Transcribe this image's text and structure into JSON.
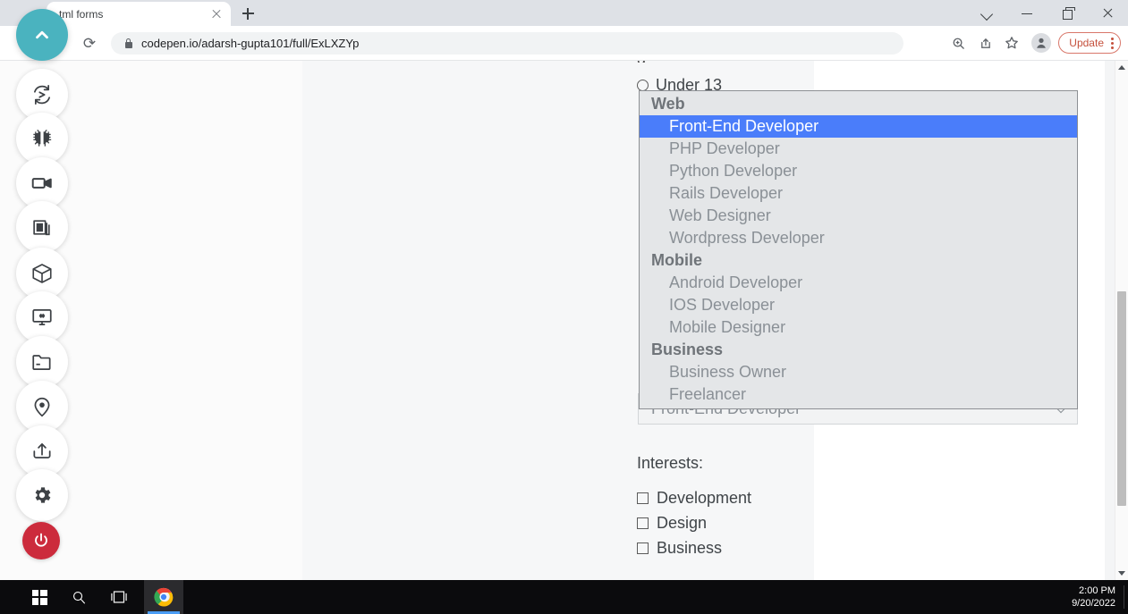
{
  "browser": {
    "tab": {
      "title": "tml forms",
      "close_icon": "close-icon"
    },
    "new_tab_icon": "plus-icon",
    "window_controls": [
      {
        "name": "chevron-down-icon",
        "label": "˅"
      },
      {
        "name": "minimize-icon",
        "label": "—"
      },
      {
        "name": "restore-icon",
        "label": "❐"
      },
      {
        "name": "close-icon",
        "label": "✕"
      }
    ],
    "reload_icon": "⟳",
    "lock_icon": "lock-icon",
    "url": "codepen.io/adarsh-gupta101/full/ExLXZYp",
    "toolbar_icons": [
      {
        "name": "zoom-icon",
        "glyph": "⊕"
      },
      {
        "name": "share-icon",
        "glyph": "↱"
      },
      {
        "name": "bookmark-star-icon",
        "glyph": "☆"
      }
    ],
    "profile_icon": "profile-avatar-icon",
    "update_button": {
      "label": "Update",
      "color": "#c5503c"
    },
    "kebab_icon": "three-dot-menu-icon"
  },
  "page": {
    "clipped_text_above": "g",
    "radio_option": {
      "label": "Under 13",
      "checked": false
    },
    "dropdown": {
      "open": true,
      "selected_value": "Front-End Developer",
      "caret_icon": "chevron-down-icon",
      "groups": [
        {
          "label": "Web",
          "options": [
            {
              "label": "Front-End Developer",
              "selected": true
            },
            {
              "label": "PHP Developer",
              "selected": false
            },
            {
              "label": "Python Developer",
              "selected": false
            },
            {
              "label": "Rails Developer",
              "selected": false
            },
            {
              "label": "Web Designer",
              "selected": false
            },
            {
              "label": "Wordpress Developer",
              "selected": false
            }
          ]
        },
        {
          "label": "Mobile",
          "options": [
            {
              "label": "Android Developer",
              "selected": false
            },
            {
              "label": "IOS Developer",
              "selected": false
            },
            {
              "label": "Mobile Designer",
              "selected": false
            }
          ]
        },
        {
          "label": "Business",
          "options": [
            {
              "label": "Business Owner",
              "selected": false
            },
            {
              "label": "Freelancer",
              "selected": false
            }
          ]
        }
      ],
      "highlight_color": "#4a7dfa"
    },
    "interests": {
      "label": "Interests:",
      "items": [
        {
          "label": "Development",
          "checked": false
        },
        {
          "label": "Design",
          "checked": false
        },
        {
          "label": "Business",
          "checked": false
        }
      ]
    }
  },
  "sidebar": {
    "accent_teal": "#4ab3bf",
    "accent_red": "#cc2b3c",
    "items": [
      {
        "name": "collapse-chevron-up-icon",
        "style": "teal"
      },
      {
        "name": "sync-icon",
        "style": "light"
      },
      {
        "name": "bug-icon",
        "style": "light"
      },
      {
        "name": "video-camera-icon",
        "style": "light"
      },
      {
        "name": "layers-icon",
        "style": "light"
      },
      {
        "name": "cube-icon",
        "style": "light"
      },
      {
        "name": "responsive-monitor-icon",
        "style": "light"
      },
      {
        "name": "folder-icon",
        "style": "light"
      },
      {
        "name": "location-pin-icon",
        "style": "light"
      },
      {
        "name": "upload-icon",
        "style": "light"
      },
      {
        "name": "gear-icon",
        "style": "light"
      },
      {
        "name": "power-icon",
        "style": "red"
      }
    ]
  },
  "taskbar": {
    "start_icon": "windows-start-icon",
    "search_icon": "search-icon",
    "taskview_icon": "task-view-icon",
    "chrome_icon": "chrome-icon",
    "clock": {
      "time": "2:00 PM",
      "date": "9/20/2022"
    }
  }
}
